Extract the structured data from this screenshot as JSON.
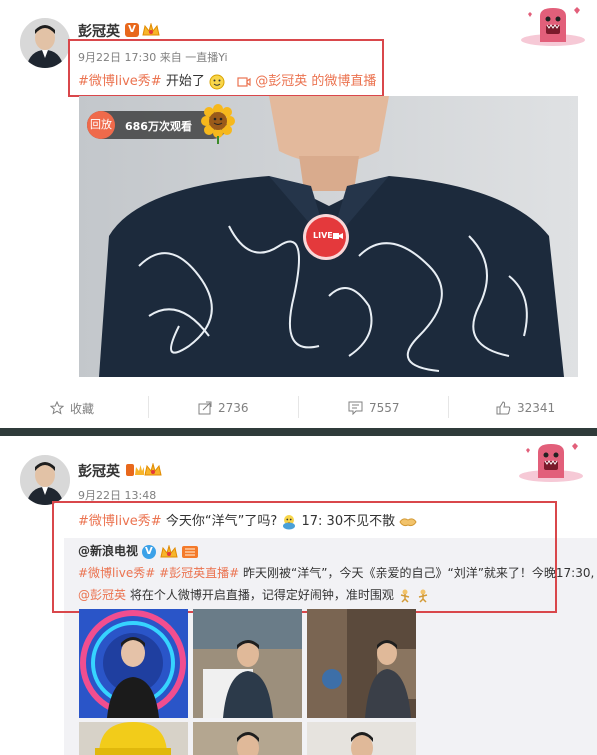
{
  "post1": {
    "author": "彭冠英",
    "verified": "V",
    "date": "9月22日 17:30",
    "source_prefix": "来自",
    "source": "一直播Yi",
    "hashtag": "#微博live秀#",
    "body": "开始了",
    "live_link": "@彭冠英 的微博直播",
    "video": {
      "replay_label": "回放",
      "viewers": "686万次观看",
      "live_label": "LIVE"
    },
    "actions": {
      "favorite": "收藏",
      "repost_count": "2736",
      "comment_count": "7557",
      "like_count": "32341"
    }
  },
  "post2": {
    "author": "彭冠英",
    "date": "9月22日 13:48",
    "hashtag": "#微博live秀#",
    "body_a": "今天你“洋气”了吗?",
    "body_b": "17:  30不见不散",
    "repost": {
      "author": "@新浪电视",
      "verified": "V",
      "tag1": "#微博live秀#",
      "tag2": "#彭冠英直播#",
      "line1_text": "昨天刚被“洋气”，今天《亲爱的自己》“刘洋”就来了！今晚17:30,",
      "mention": "@彭冠英",
      "line2_text": "将在个人微博开启直播，记得定好闹钟，准时围观"
    }
  },
  "colors": {
    "accent": "#eb7350",
    "highlight_box": "#d9474b",
    "live_red": "#e4393c",
    "divider": "#2f3b3a"
  }
}
